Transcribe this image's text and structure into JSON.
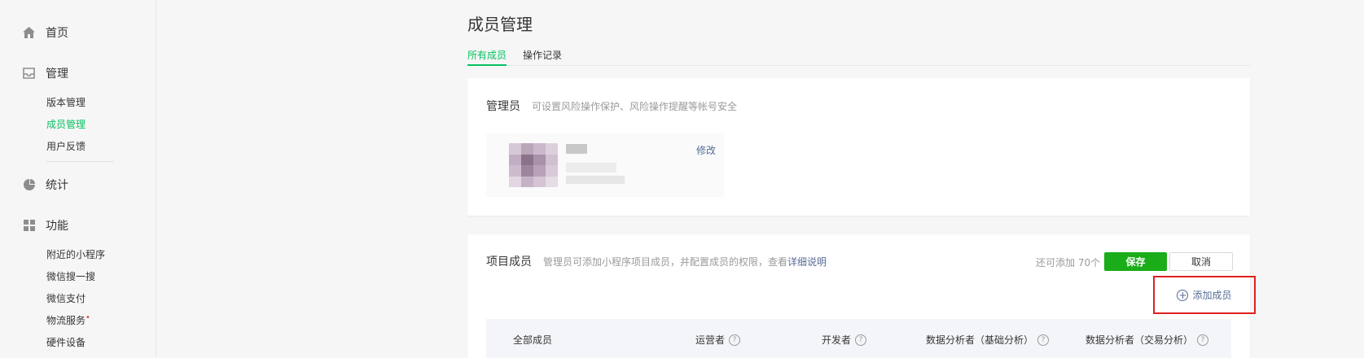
{
  "sidebar": {
    "home": "首页",
    "manage": "管理",
    "manage_items": [
      "版本管理",
      "成员管理",
      "用户反馈"
    ],
    "stats": "统计",
    "features": "功能",
    "feature_items": [
      "附近的小程序",
      "微信搜一搜",
      "微信支付",
      "物流服务",
      "硬件设备"
    ]
  },
  "page": {
    "title": "成员管理",
    "tabs": [
      "所有成员",
      "操作记录"
    ]
  },
  "admin_card": {
    "title": "管理员",
    "desc": "可设置风险操作保护、风险操作提醒等帐号安全",
    "edit": "修改"
  },
  "members_card": {
    "title": "项目成员",
    "desc": "管理员可添加小程序项目成员，并配置成员的权限，查看",
    "desc_link": "详细说明",
    "remain": "还可添加 70个",
    "save": "保存",
    "cancel": "取消",
    "add_member": "添加成员",
    "columns": [
      "全部成员",
      "运营者",
      "开发者",
      "数据分析者（基础分析）",
      "数据分析者（交易分析）"
    ]
  },
  "colors": {
    "accent": "#07c160",
    "save_button": "#1aad19",
    "highlight_border": "#e02020",
    "link": "#576b95"
  },
  "icons": [
    "home-icon",
    "inbox-icon",
    "pie-chart-icon",
    "grid-icon",
    "plus-circle-icon",
    "question-icon"
  ]
}
